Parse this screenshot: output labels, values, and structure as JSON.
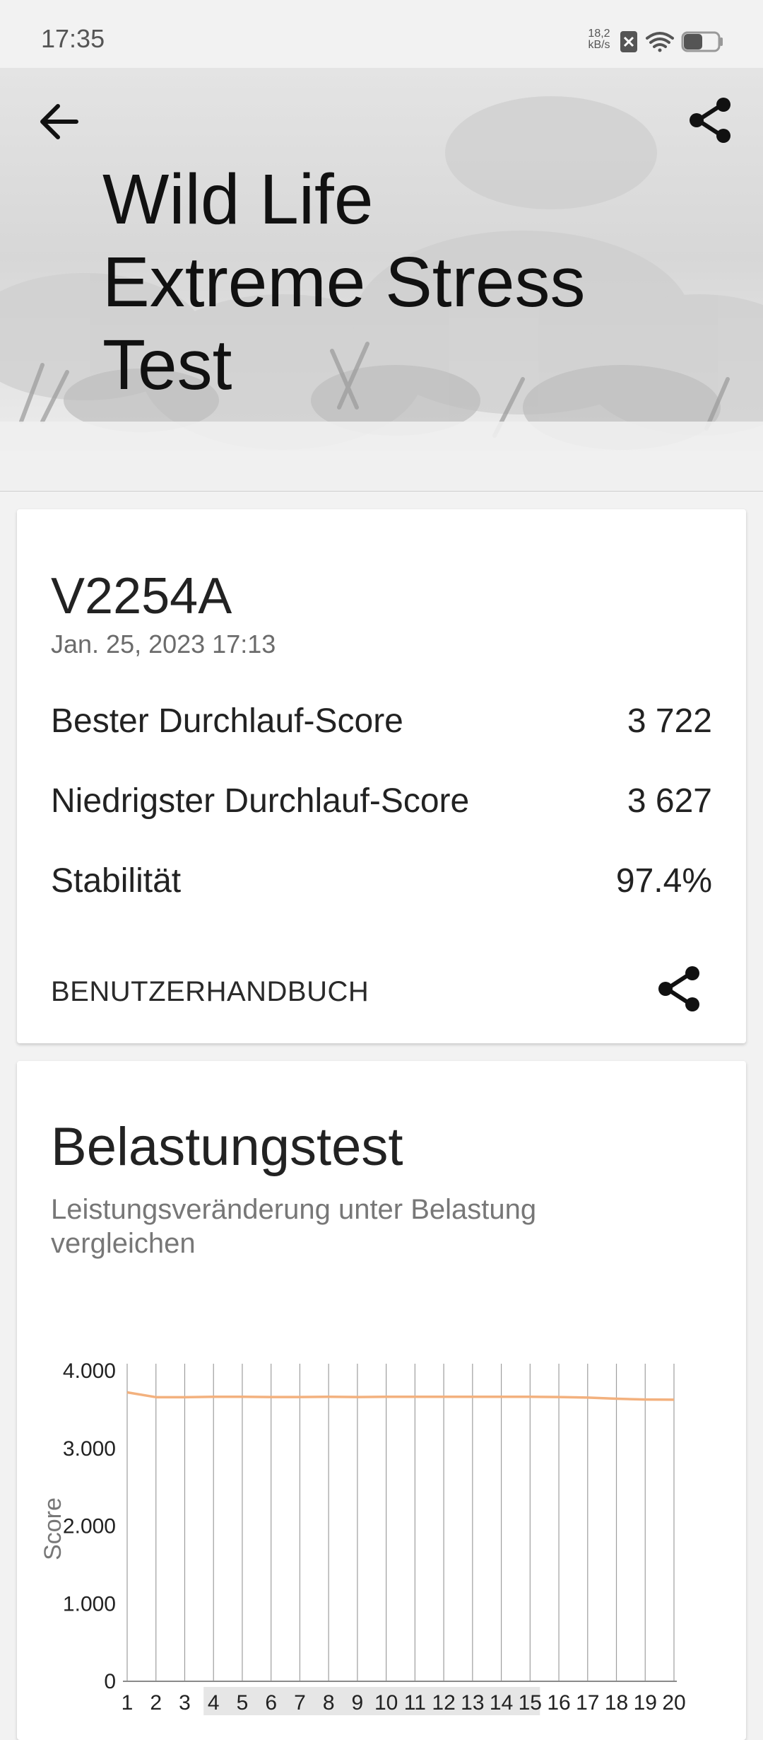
{
  "status_bar": {
    "time": "17:35",
    "net_speed_value": "18,2",
    "net_speed_unit": "kB/s",
    "icons": [
      "sim-blocked-icon",
      "wifi-icon",
      "battery-icon"
    ]
  },
  "header": {
    "title_line1": "Wild Life",
    "title_line2": "Extreme Stress",
    "title_line3": "Test",
    "back_icon": "arrow-left-icon",
    "share_icon": "share-icon"
  },
  "result_card": {
    "device": "V2254A",
    "date": "Jan. 25, 2023 17:13",
    "rows": [
      {
        "label": "Bester Durchlauf-Score",
        "value": "3 722"
      },
      {
        "label": "Niedrigster Durchlauf-Score",
        "value": "3 627"
      },
      {
        "label": "Stabilität",
        "value": "97.4%"
      }
    ],
    "manual_label": "BENUTZERHANDBUCH"
  },
  "stress_section": {
    "title": "Belastungstest",
    "subtitle": "Leistungsveränderung unter Belastung vergleichen"
  },
  "chart_data": {
    "type": "line",
    "ylabel": "Score",
    "ylim": [
      0,
      4000
    ],
    "y_ticks": [
      "0",
      "1.000",
      "2.000",
      "3.000",
      "4.000"
    ],
    "x": [
      1,
      2,
      3,
      4,
      5,
      6,
      7,
      8,
      9,
      10,
      11,
      12,
      13,
      14,
      15,
      16,
      17,
      18,
      19,
      20
    ],
    "series": [
      {
        "values": [
          3722,
          3660,
          3660,
          3665,
          3665,
          3662,
          3662,
          3665,
          3662,
          3665,
          3665,
          3665,
          3665,
          3665,
          3665,
          3662,
          3655,
          3640,
          3630,
          3627
        ],
        "color": "#f3b17e"
      }
    ],
    "grid": "vertical",
    "highlight_range": [
      4,
      15
    ]
  }
}
